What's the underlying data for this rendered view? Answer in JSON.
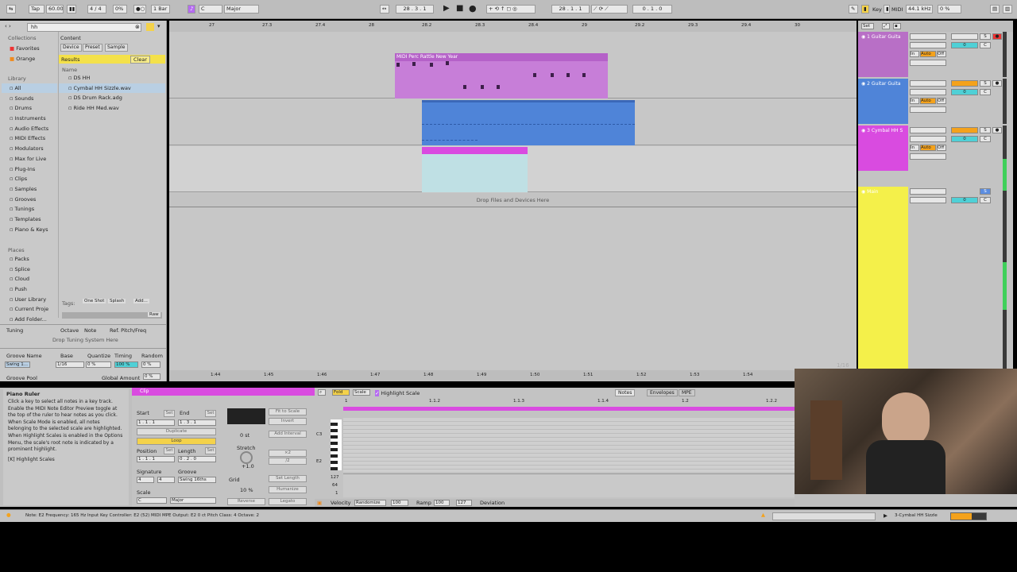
{
  "toolbar": {
    "tap": "Tap",
    "tempo": "60.00",
    "sig": "4 / 4",
    "zoom": "0%",
    "quant": "1 Bar",
    "key": "C",
    "scale": "Major",
    "pos": "28 . 3 . 1",
    "loop_start": "28 . 1 . 1",
    "loop_len": "0 . 1 . 0",
    "key_label": "Key",
    "midi_label": "MIDI",
    "rate": "44.1 kHz",
    "cpu": "0 %"
  },
  "browser": {
    "search": "hh",
    "collections_title": "Collections",
    "favorites": "Favorites",
    "orange": "Orange",
    "library_title": "Library",
    "library": [
      "All",
      "Sounds",
      "Drums",
      "Instruments",
      "Audio Effects",
      "MIDI Effects",
      "Modulators",
      "Max for Live",
      "Plug-Ins",
      "Clips",
      "Samples",
      "Grooves",
      "Tunings",
      "Templates",
      "Piano & Keys"
    ],
    "places_title": "Places",
    "places": [
      "Packs",
      "Splice",
      "Cloud",
      "Push",
      "User Library",
      "Current Proje",
      "Add Folder..."
    ],
    "filter_tabs": [
      "Device",
      "Preset",
      "Sample"
    ],
    "content": "Content",
    "results": "Results",
    "clear": "Clear",
    "name_col": "Name",
    "results_list": [
      "DS HH",
      "Cymbal HH Sizzle.wav",
      "DS Drum Rack.adg",
      "Ride HH Med.wav"
    ],
    "tags_label": "Tags:",
    "tags": [
      "One Shot",
      "Splash",
      "Add..."
    ],
    "raw": "Raw",
    "tuning": {
      "label": "Tuning",
      "octave": "Octave",
      "note": "Note",
      "ref": "Ref. Pitch/Freq",
      "drop": "Drop Tuning System Here"
    },
    "groove": {
      "name": "Groove Name",
      "base": "Base",
      "quant": "Quantize",
      "timing": "Timing",
      "random": "Random",
      "row_name": "Swing 1...",
      "row_base": "1/16",
      "row_quant": "0 %",
      "row_timing": "100 %",
      "row_random": "0 %",
      "pool": "Groove Pool",
      "global": "Global Amount",
      "global_val": "0 %"
    }
  },
  "arrangement": {
    "ruler": [
      "27",
      "27.3",
      "27.4",
      "28",
      "28.2",
      "28.3",
      "28.4",
      "29",
      "29.2",
      "29.3",
      "29.4",
      "30"
    ],
    "time_ruler": [
      "1:44",
      "1:45",
      "1:46",
      "1:47",
      "1:48",
      "1:49",
      "1:50",
      "1:51",
      "1:52",
      "1:53",
      "1:54"
    ],
    "clip1_name": "MIDI Perc Rattle New Year",
    "drop": "Drop Files and Devices Here",
    "set": "Set",
    "page": "1/16"
  },
  "tracks": [
    {
      "name": "1 Guitar Guita",
      "num": "1",
      "color": "#b86fc6",
      "input": "All Ins",
      "chan": "All Channe",
      "out": "Main"
    },
    {
      "name": "2 Guitar Guita",
      "num": "2",
      "color": "#4f84d8",
      "input": "All Ins",
      "chan": "All Channe",
      "out": "Main"
    },
    {
      "name": "3 Cymbal HH S",
      "num": "3",
      "color": "#d94be0",
      "input": "All Ins",
      "chan": "All Channe",
      "out": "Main"
    },
    {
      "name": "Main",
      "num": "",
      "color": "#f4f04a",
      "input": "1/2",
      "chan": "1/2",
      "out": ""
    }
  ],
  "mixer_common": {
    "in": "In",
    "auto": "Auto",
    "off": "Off",
    "s": "S",
    "c": "C",
    "zero": "0"
  },
  "info": {
    "title": "Piano Ruler",
    "text": "Click a key to select all notes in a key track. Enable the MIDI Note Editor Preview toggle at the top of the ruler to hear notes as you click. When Scale Mode is enabled, all notes belonging to the selected scale are highlighted. When Highlight Scales is enabled in the Options Menu, the scale's root note is indicated by a prominent highlight.",
    "shortcut": "[K] Highlight Scales"
  },
  "clipview": {
    "clip": "Clip",
    "start": "Start",
    "end": "End",
    "set": "Set",
    "start_val": "1 . 1 . 1",
    "end_val": "1 . 3 . 1",
    "duplicate": "Duplicate",
    "loop": "Loop",
    "position": "Position",
    "length": "Length",
    "pos_val": "1 . 1 . 1",
    "len_val": "0 . 2 . 0",
    "signature": "Signature",
    "groove": "Groove",
    "sig_num": "4",
    "sig_den": "4",
    "groove_val": "Swing 16ths",
    "scale": "Scale",
    "scale_root": "C",
    "scale_name": "Major",
    "fit": "Fit to Scale",
    "invert": "Invert",
    "add_interval": "Add Interval",
    "x2": "×2",
    "div2": "/2",
    "set_length": "Set Length",
    "humanize": "Humanize",
    "reverse": "Reverse",
    "legato": "Legato",
    "stretch": "Stretch",
    "stretch_val": "+1.0",
    "pitch_val": "0 st",
    "grid": "Grid",
    "grid_pct": "10 %"
  },
  "note_editor": {
    "fold": "Fold",
    "scale": "Scale",
    "highlight": "Highlight Scale",
    "tabs": [
      "Notes",
      "Envelopes",
      "MPE"
    ],
    "ruler": [
      "1",
      "1.1.2",
      "1.1.3",
      "1.1.4",
      "1.2",
      "1.2.2"
    ],
    "c3": "C3",
    "e2": "E2",
    "vel_top": "127",
    "vel_mid": "64",
    "vel_bot": "1",
    "velocity": "Velocity",
    "randomize": "Randomize",
    "vel_val": "100",
    "ramp": "Ramp",
    "ramp1": "100",
    "ramp2": "127",
    "deviation": "Deviation"
  },
  "status": {
    "text": "Note: E2   Frequency: 165 Hz   Input Key Controller: E2 (52)   MIDI MPE Output: E2 0 ct   Pitch Class: 4 Octave: 2",
    "track": "3-Cymbal HH Sizzle"
  }
}
